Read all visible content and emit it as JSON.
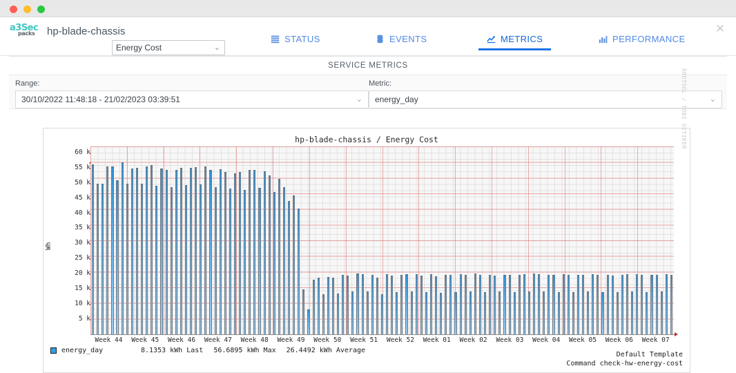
{
  "window": {
    "traffic_lights": [
      "close",
      "minimize",
      "zoom"
    ]
  },
  "header": {
    "logo_main": "a3Sec",
    "logo_sub": "packs",
    "host": "hp-blade-chassis",
    "service_select_value": "Energy Cost",
    "close_label": "✕",
    "tabs": [
      {
        "label": "STATUS",
        "icon": "list-icon",
        "active": false
      },
      {
        "label": "EVENTS",
        "icon": "database-icon",
        "active": false
      },
      {
        "label": "METRICS",
        "icon": "line-chart-icon",
        "active": true
      },
      {
        "label": "PERFORMANCE",
        "icon": "bar-chart-icon",
        "active": false
      }
    ]
  },
  "section": {
    "title": "SERVICE METRICS"
  },
  "filters": {
    "range_label": "Range:",
    "range_value": "30/10/2022 11:48:18 - 21/02/2023 03:39:51",
    "metric_label": "Metric:",
    "metric_value": "energy_day",
    "caret": "⌄"
  },
  "graph": {
    "title": "hp-blade-chassis / Energy Cost",
    "watermark": "RRDTOOL / TOBI OETIKER",
    "legend": {
      "swatch_color": "#2f9fe8",
      "name": "energy_day",
      "stats": [
        "8.1353 kWh Last",
        "56.6895 kWh Max",
        "26.4492 kWh Average"
      ]
    },
    "footer_line1": "Default Template",
    "footer_line2": "Command check-hw-energy-cost"
  },
  "chart_data": {
    "type": "bar",
    "title": "hp-blade-chassis / Energy Cost",
    "xlabel": "",
    "ylabel": "Wh",
    "ylim": [
      0,
      62000
    ],
    "grid": true,
    "legend_position": "bottom-left",
    "unit": "kWh",
    "y_ticks": [
      5000,
      10000,
      15000,
      20000,
      25000,
      30000,
      35000,
      40000,
      45000,
      50000,
      55000,
      60000
    ],
    "y_tick_labels": [
      "5 k",
      "10 k",
      "15 k",
      "20 k",
      "25 k",
      "30 k",
      "35 k",
      "40 k",
      "45 k",
      "50 k",
      "55 k",
      "60 k"
    ],
    "x_tick_labels": [
      "Week 44",
      "Week 45",
      "Week 46",
      "Week 47",
      "Week 48",
      "Week 49",
      "Week 50",
      "Week 51",
      "Week 52",
      "Week 01",
      "Week 02",
      "Week 03",
      "Week 04",
      "Week 05",
      "Week 06",
      "Week 07"
    ],
    "series": [
      {
        "name": "energy_day",
        "color": "#3d9ada",
        "last": 8135.3,
        "max": 56689.5,
        "average": 26449.2,
        "values": [
          56100,
          49600,
          49700,
          55300,
          55400,
          50900,
          56700,
          49600,
          54800,
          55000,
          49700,
          55300,
          55900,
          48900,
          54700,
          54200,
          48600,
          54300,
          55000,
          49200,
          55000,
          55200,
          49400,
          55300,
          54300,
          48600,
          54500,
          53600,
          48000,
          53200,
          53500,
          47700,
          54300,
          54200,
          48300,
          53900,
          52500,
          47000,
          51200,
          48500,
          44000,
          45900,
          41500,
          14800,
          8100,
          17900,
          18600,
          13300,
          19000,
          18800,
          13500,
          19500,
          19400,
          14200,
          20100,
          19800,
          14100,
          19500,
          18600,
          13200,
          19900,
          19300,
          14000,
          19600,
          19800,
          14100,
          19900,
          19300,
          13900,
          19800,
          19200,
          13700,
          19600,
          19500,
          14000,
          19800,
          19700,
          14200,
          20000,
          19600,
          13900,
          19500,
          19400,
          14100,
          19700,
          19500,
          13800,
          19600,
          19800,
          14200,
          20000,
          19900,
          14100,
          19700,
          19600,
          13900,
          19800,
          19500,
          14000,
          19600,
          19700,
          14100,
          19900,
          19600,
          13800,
          19500,
          19400,
          14000,
          19700,
          19800,
          14200,
          19900,
          19500,
          13900,
          19600,
          19700,
          14100,
          19800,
          19600
        ]
      }
    ]
  }
}
